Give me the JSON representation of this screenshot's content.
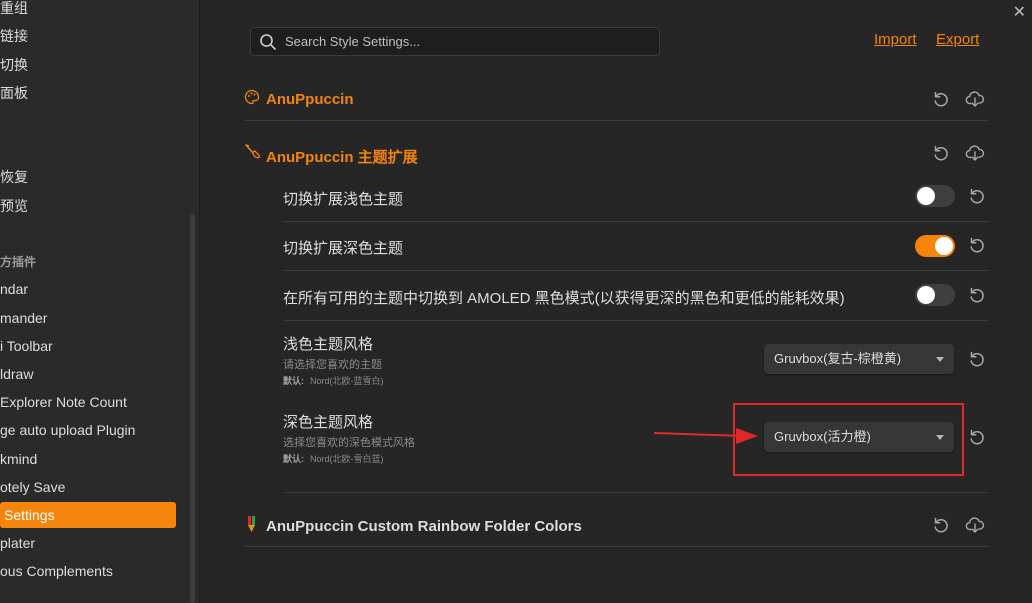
{
  "sidebar": {
    "items": [
      {
        "label": "重组"
      },
      {
        "label": "链接"
      },
      {
        "label": "切换"
      },
      {
        "label": "面板"
      },
      {
        "label": "恢复"
      },
      {
        "label": "预览"
      },
      {
        "label": "ndar"
      },
      {
        "label": "mander"
      },
      {
        "label": "i Toolbar"
      },
      {
        "label": "ldraw"
      },
      {
        "label": "Explorer Note Count"
      },
      {
        "label": "ge auto upload Plugin"
      },
      {
        "label": "kmind"
      },
      {
        "label": "otely Save"
      },
      {
        "label": "Settings"
      },
      {
        "label": "plater"
      },
      {
        "label": "ous Complements"
      }
    ],
    "heading": "方插件",
    "active_index": 14
  },
  "header": {
    "search_placeholder": "Search Style Settings...",
    "import_label": "Import",
    "export_label": "Export"
  },
  "sections": {
    "anuppuccin": {
      "title": "AnuPpuccin"
    },
    "extension": {
      "title": "AnuPpuccin 主题扩展"
    },
    "rainbow": {
      "title": "AnuPpuccin Custom Rainbow Folder Colors"
    }
  },
  "settings": {
    "light_switch": {
      "title": "切换扩展浅色主题",
      "enabled": false
    },
    "dark_switch": {
      "title": "切换扩展深色主题",
      "enabled": true
    },
    "amoled": {
      "title": "在所有可用的主题中切换到 AMOLED 黑色模式(以获得更深的黑色和更低的能耗效果)",
      "enabled": false
    },
    "light_style": {
      "title": "浅色主题风格",
      "desc": "请选择您喜欢的主题",
      "default_label": "默认:",
      "default_value": "Nord(北欧-蓝雪白)",
      "selected": "Gruvbox(复古-棕橙黄)"
    },
    "dark_style": {
      "title": "深色主题风格",
      "desc": "选择您喜欢的深色模式风格",
      "default_label": "默认:",
      "default_value": "Nord(北欧-雪白蓝)",
      "selected": "Gruvbox(活力橙)"
    }
  },
  "colors": {
    "accent": "#f5840c",
    "annotation": "#e0282b"
  }
}
